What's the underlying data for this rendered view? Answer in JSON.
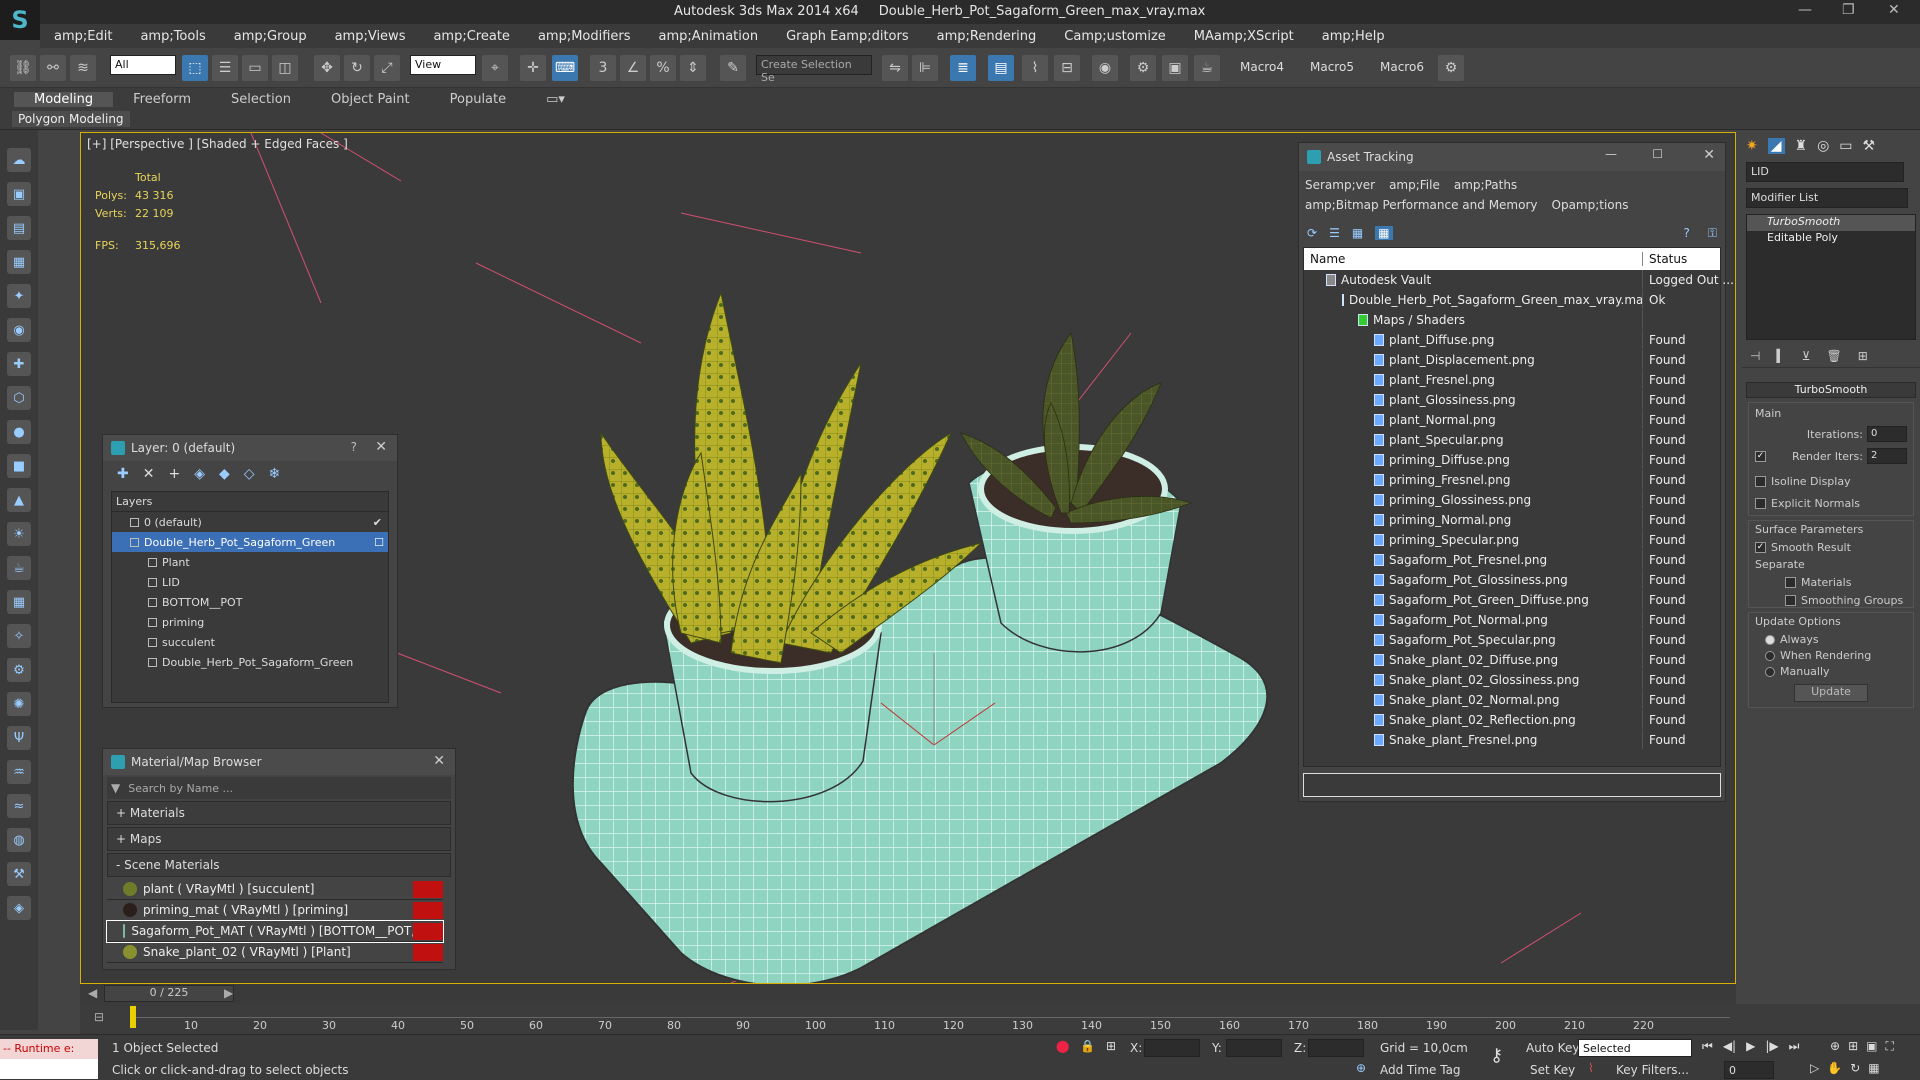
{
  "window": {
    "app": "Autodesk 3ds Max  2014 x64",
    "file": "Double_Herb_Pot_Sagaform_Green_max_vray.max"
  },
  "menu": [
    "amp;Edit",
    "amp;Tools",
    "amp;Group",
    "amp;Views",
    "amp;Create",
    "amp;Modifiers",
    "amp;Animation",
    "Graph Eamp;ditors",
    "amp;Rendering",
    "Camp;ustomize",
    "MAamp;XScript",
    "amp;Help"
  ],
  "toolbar": {
    "filter": "All",
    "refcoord": "View",
    "selset": "Create Selection Se",
    "macros": [
      "Macro4",
      "Macro5",
      "Macro6"
    ]
  },
  "ribbon": {
    "tabs": [
      "Modeling",
      "Freeform",
      "Selection",
      "Object Paint",
      "Populate"
    ],
    "sub": "Polygon Modeling"
  },
  "viewport": {
    "label": "[+] [Perspective ] [Shaded + Edged Faces ]",
    "total": "Total",
    "polys_label": "Polys:",
    "polys": "43 316",
    "verts_label": "Verts:",
    "verts": "22 109",
    "fps_label": "FPS:",
    "fps": "315,696"
  },
  "layer": {
    "title": "Layer: 0 (default)",
    "header": "Layers",
    "rows": [
      {
        "name": "0 (default)",
        "indent": 1
      },
      {
        "name": "Double_Herb_Pot_Sagaform_Green",
        "indent": 1
      },
      {
        "name": "Plant",
        "indent": 2
      },
      {
        "name": "LID",
        "indent": 2
      },
      {
        "name": "BOTTOM__POT",
        "indent": 2
      },
      {
        "name": "priming",
        "indent": 2
      },
      {
        "name": "succulent",
        "indent": 2
      },
      {
        "name": "Double_Herb_Pot_Sagaform_Green",
        "indent": 2
      }
    ]
  },
  "material": {
    "title": "Material/Map Browser",
    "search": "Search by Name ...",
    "sections": [
      "+ Materials",
      "+ Maps",
      "- Scene Materials"
    ],
    "rows": [
      {
        "name": "plant  ( VRayMtl ) [succulent]",
        "color": "#6f7d2a"
      },
      {
        "name": "priming_mat  ( VRayMtl ) [priming]",
        "color": "#2a1f1a"
      },
      {
        "name": "Sagaform_Pot_MAT  ( VRayMtl ) [BOTTOM__POT, LID]",
        "color": "#7fb8a8"
      },
      {
        "name": "Snake_plant_02  ( VRayMtl ) [Plant]",
        "color": "#8a8f30"
      }
    ]
  },
  "asset": {
    "title": "Asset Tracking",
    "menu": [
      "Seramp;ver",
      "amp;File",
      "amp;Paths",
      "amp;Bitmap Performance and Memory",
      "Opamp;tions"
    ],
    "col_name": "Name",
    "col_status": "Status",
    "rows": [
      {
        "name": "Autodesk Vault",
        "status": "Logged Out ...",
        "indent": 0
      },
      {
        "name": "Double_Herb_Pot_Sagaform_Green_max_vray.max",
        "status": "Ok",
        "indent": 1
      },
      {
        "name": "Maps / Shaders",
        "status": "",
        "indent": 2
      },
      {
        "name": "plant_Diffuse.png",
        "status": "Found",
        "indent": 3
      },
      {
        "name": "plant_Displacement.png",
        "status": "Found",
        "indent": 3
      },
      {
        "name": "plant_Fresnel.png",
        "status": "Found",
        "indent": 3
      },
      {
        "name": "plant_Glossiness.png",
        "status": "Found",
        "indent": 3
      },
      {
        "name": "plant_Normal.png",
        "status": "Found",
        "indent": 3
      },
      {
        "name": "plant_Specular.png",
        "status": "Found",
        "indent": 3
      },
      {
        "name": "priming_Diffuse.png",
        "status": "Found",
        "indent": 3
      },
      {
        "name": "priming_Fresnel.png",
        "status": "Found",
        "indent": 3
      },
      {
        "name": "priming_Glossiness.png",
        "status": "Found",
        "indent": 3
      },
      {
        "name": "priming_Normal.png",
        "status": "Found",
        "indent": 3
      },
      {
        "name": "priming_Specular.png",
        "status": "Found",
        "indent": 3
      },
      {
        "name": "Sagaform_Pot_Fresnel.png",
        "status": "Found",
        "indent": 3
      },
      {
        "name": "Sagaform_Pot_Glossiness.png",
        "status": "Found",
        "indent": 3
      },
      {
        "name": "Sagaform_Pot_Green_Diffuse.png",
        "status": "Found",
        "indent": 3
      },
      {
        "name": "Sagaform_Pot_Normal.png",
        "status": "Found",
        "indent": 3
      },
      {
        "name": "Sagaform_Pot_Specular.png",
        "status": "Found",
        "indent": 3
      },
      {
        "name": "Snake_plant_02_Diffuse.png",
        "status": "Found",
        "indent": 3
      },
      {
        "name": "Snake_plant_02_Glossiness.png",
        "status": "Found",
        "indent": 3
      },
      {
        "name": "Snake_plant_02_Normal.png",
        "status": "Found",
        "indent": 3
      },
      {
        "name": "Snake_plant_02_Reflection.png",
        "status": "Found",
        "indent": 3
      },
      {
        "name": "Snake_plant_Fresnel.png",
        "status": "Found",
        "indent": 3
      }
    ]
  },
  "command": {
    "object_name": "LID",
    "modifier_list": "Modifier List",
    "stack": [
      "TurboSmooth",
      "Editable Poly"
    ],
    "rollout": "TurboSmooth",
    "main": "Main",
    "iterations_label": "Iterations:",
    "iterations": "0",
    "render_iters_label": "Render Iters:",
    "render_iters": "2",
    "isoline": "Isoline Display",
    "explicit": "Explicit Normals",
    "surface": "Surface Parameters",
    "smooth_result": "Smooth Result",
    "separate": "Separate",
    "materials": "Materials",
    "smoothing_groups": "Smoothing Groups",
    "update_options": "Update Options",
    "always": "Always",
    "when_rendering": "When Rendering",
    "manually": "Manually",
    "update": "Update"
  },
  "timeline": {
    "frame": "0 / 225",
    "ticks": [
      "10",
      "20",
      "30",
      "40",
      "50",
      "60",
      "70",
      "80",
      "90",
      "100",
      "110",
      "120",
      "130",
      "140",
      "150",
      "160",
      "170",
      "180",
      "190",
      "200",
      "210",
      "220"
    ]
  },
  "status": {
    "runtime": "-- Runtime e:",
    "selected": "1 Object Selected",
    "prompt": "Click or click-and-drag to select objects",
    "x": "X:",
    "y": "Y:",
    "z": "Z:",
    "grid": "Grid = 10,0cm",
    "add_time_tag": "Add Time Tag",
    "auto_key": "Auto Key",
    "set_key": "Set Key",
    "selected_dd": "Selected",
    "key_filters": "Key Filters...",
    "frame_field": "0"
  }
}
